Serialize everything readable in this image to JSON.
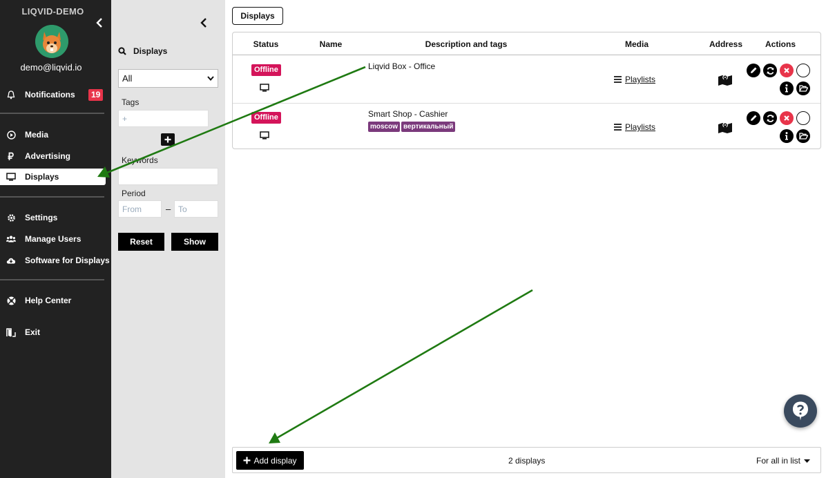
{
  "sidebar": {
    "title": "LIQVID-DEMO",
    "email": "demo@liqvid.io",
    "notifications": {
      "label": "Notifications",
      "count": "19"
    },
    "items": [
      {
        "label": "Media",
        "icon": "play-icon"
      },
      {
        "label": "Advertising",
        "icon": "ruble-icon"
      },
      {
        "label": "Displays",
        "icon": "monitor-icon",
        "active": true
      },
      {
        "label": "Settings",
        "icon": "gear-icon"
      },
      {
        "label": "Manage Users",
        "icon": "users-icon"
      },
      {
        "label": "Software for Displays",
        "icon": "cloud-download-icon"
      },
      {
        "label": "Help Center",
        "icon": "lifebuoy-icon"
      },
      {
        "label": "Exit",
        "icon": "exit-icon"
      }
    ]
  },
  "filter": {
    "heading": "Displays",
    "select_value": "All",
    "tags_label": "Tags",
    "tags_placeholder": "+",
    "keywords_label": "Keywords",
    "period_label": "Period",
    "from_placeholder": "From",
    "to_placeholder": "To",
    "period_sep": "–",
    "reset_label": "Reset",
    "show_label": "Show"
  },
  "main": {
    "tab_label": "Displays",
    "columns": [
      "Status",
      "Name",
      "Description and tags",
      "Media",
      "Address",
      "Actions"
    ],
    "rows": [
      {
        "status": "Offline",
        "description": "Liqvid Box - Office",
        "tags": [],
        "media": "Playlists"
      },
      {
        "status": "Offline",
        "description": "Smart Shop - Cashier",
        "tags": [
          "moscow",
          "вертикальный"
        ],
        "media": "Playlists"
      }
    ],
    "footer": {
      "add_label": "Add display",
      "count_text": "2 displays",
      "scope_label": "For all in list"
    }
  },
  "colors": {
    "sidebar_bg": "#222222",
    "filter_bg": "#e4e4e4",
    "offline_badge": "#d4145a",
    "tag_bg": "#7b3a7c",
    "notification_badge": "#e8344a",
    "delete_action": "#e8344a",
    "help_button": "#3a4a5e",
    "annotation_arrow": "#1f7a12"
  }
}
